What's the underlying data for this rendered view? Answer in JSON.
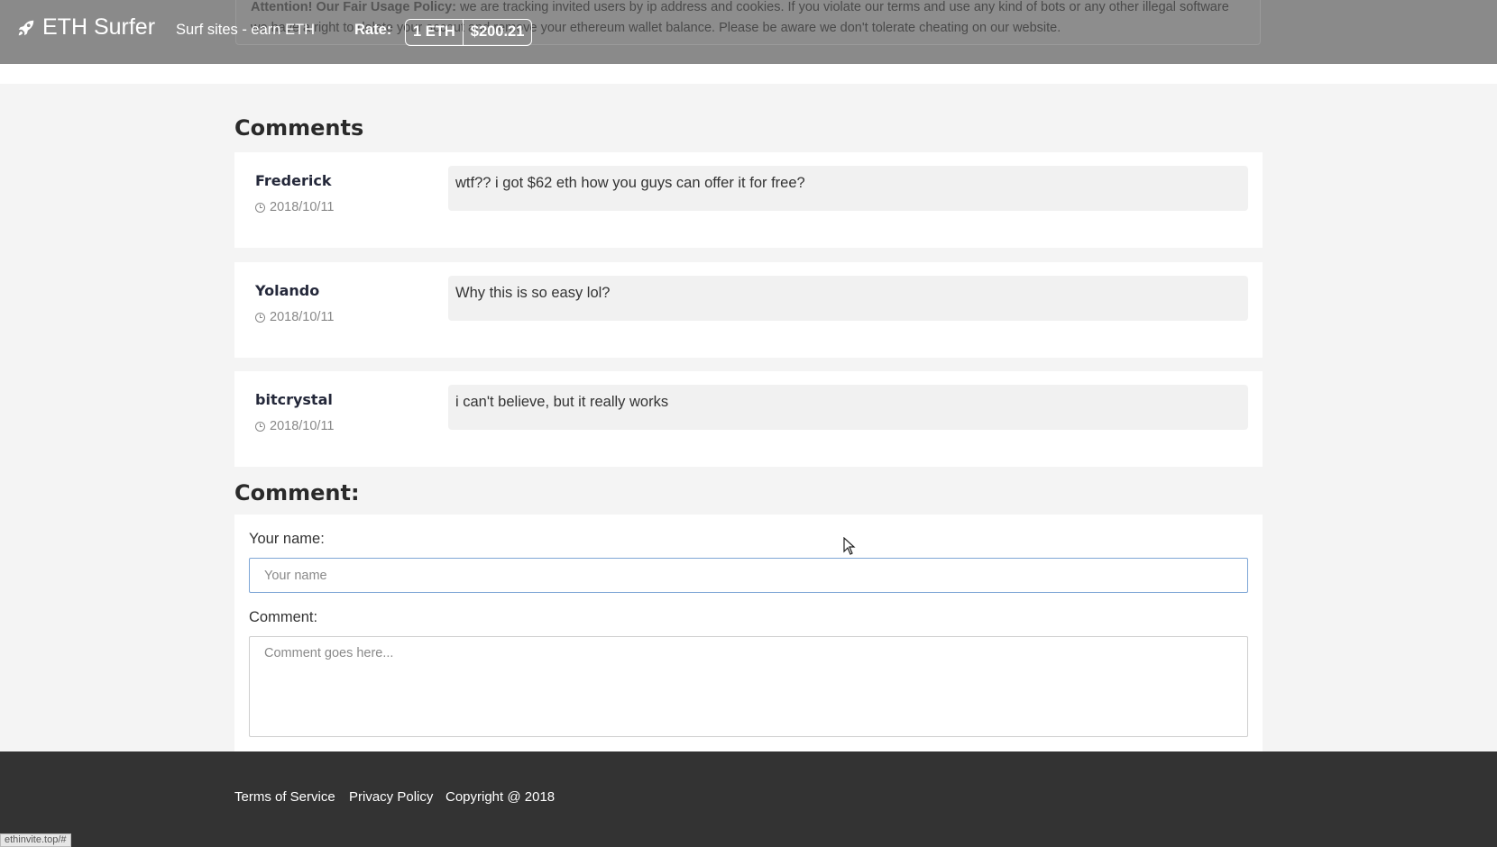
{
  "header": {
    "notice_bold": "Attention! Our Fair Usage Policy:",
    "notice_line1": "we are tracking invited users by ip address and cookies. If you violate our terms and use any kind of bots or any other illegal software",
    "notice_line2": "we have a right to delete your accout and remove your ethereum wallet balance. Please be aware we don't tolerate cheating on our website.",
    "brand": "ETH Surfer",
    "tagline": "Surf sites - earn ETH",
    "rate_label": "Rate:",
    "rate_unit": "1 ETH",
    "rate_value": "$200.21"
  },
  "comments": {
    "title": "Comments",
    "items": [
      {
        "author": "Frederick",
        "date": "2018/10/11",
        "text": "wtf?? i got $62 eth how you guys can offer it for free?"
      },
      {
        "author": "Yolando",
        "date": "2018/10/11",
        "text": "Why this is so easy lol?"
      },
      {
        "author": "bitcrystal",
        "date": "2018/10/11",
        "text": "i can't believe, but it really works"
      }
    ]
  },
  "form": {
    "title": "Comment:",
    "name_label": "Your name:",
    "name_placeholder": "Your name",
    "comment_label": "Comment:",
    "comment_placeholder": "Comment goes here..."
  },
  "footer": {
    "terms": "Terms of Service",
    "privacy": "Privacy Policy",
    "copyright": "Copyright @ 2018"
  },
  "status_bar": {
    "url": "ethinvite.top/#"
  }
}
